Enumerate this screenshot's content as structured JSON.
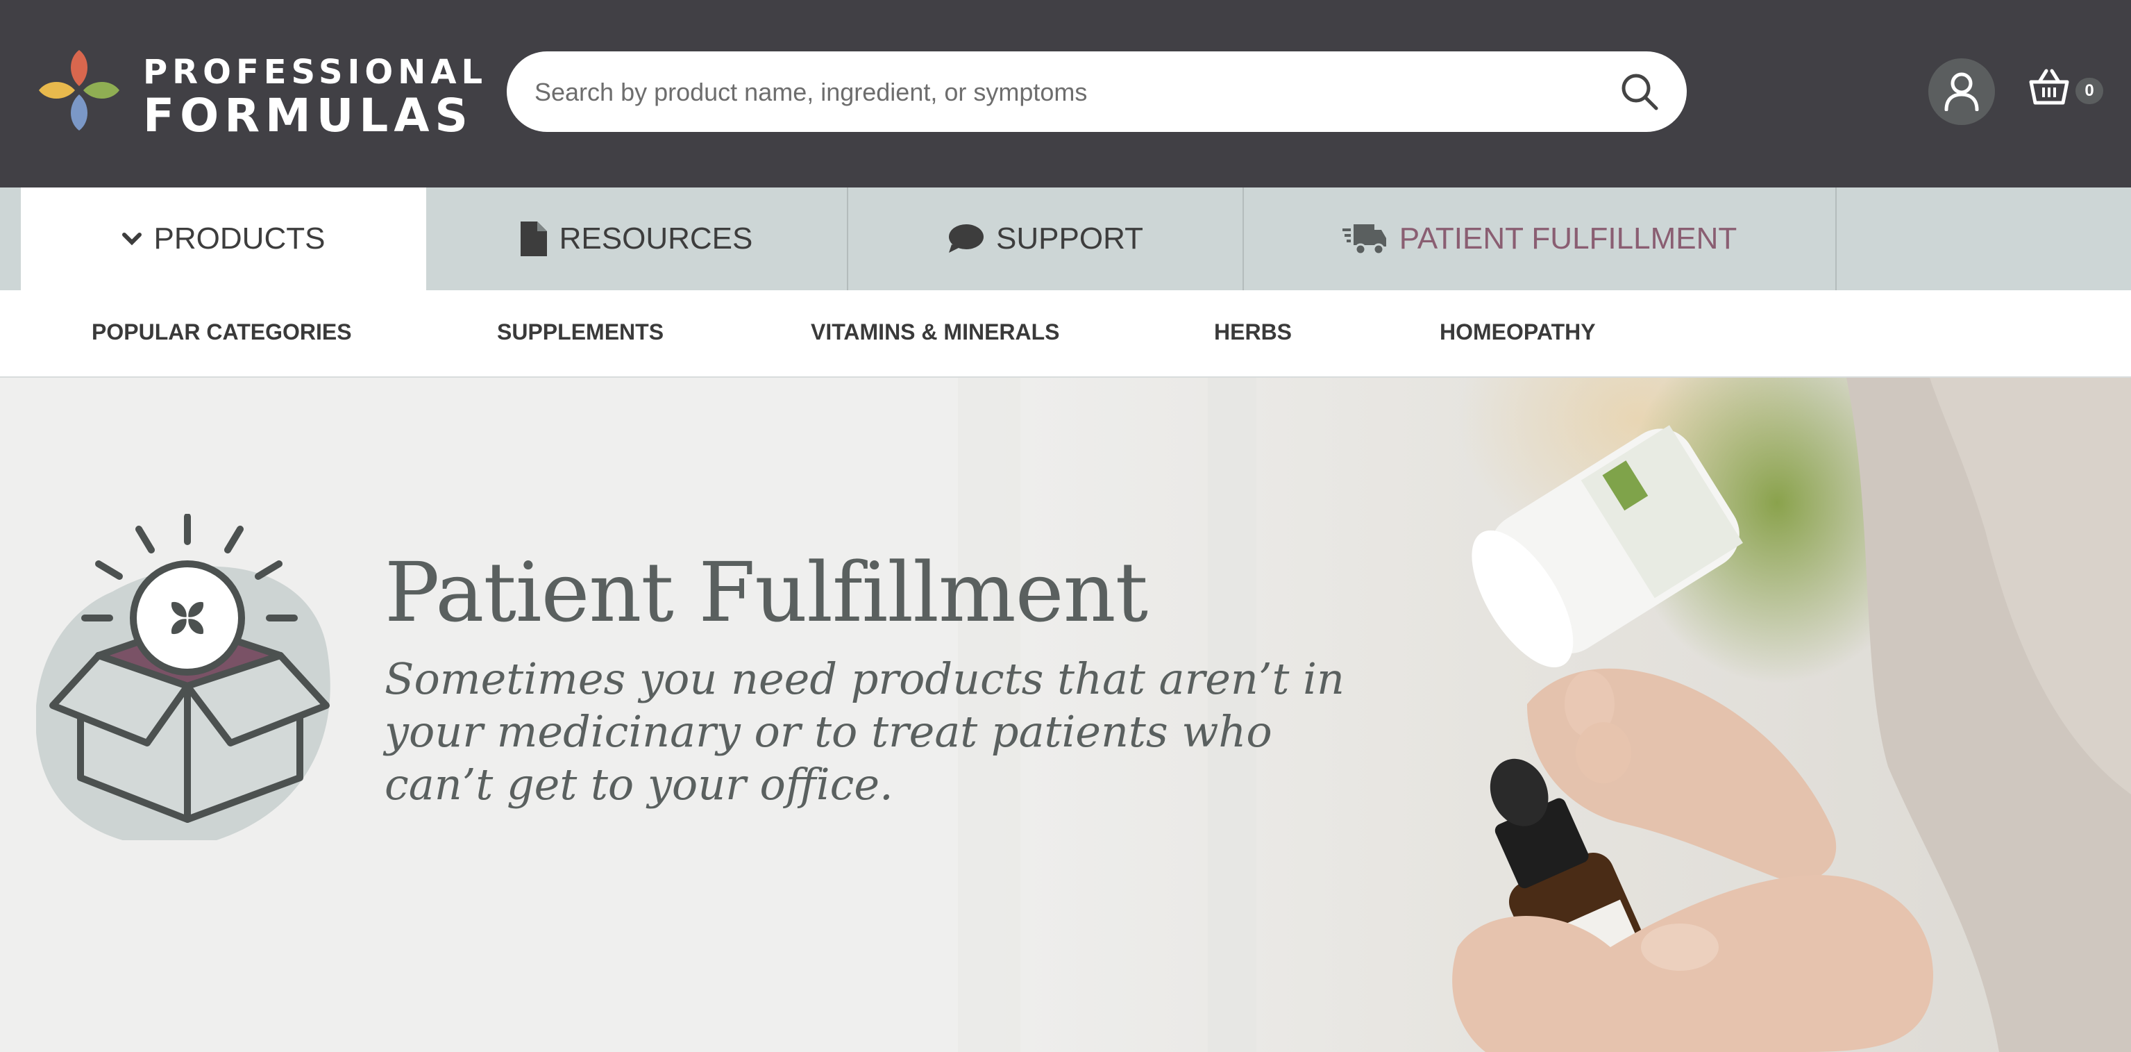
{
  "brand": {
    "line1": "PROFESSIONAL",
    "line2": "FORMULAS",
    "colors": {
      "red": "#d9674e",
      "yellow": "#e8b94d",
      "green": "#8fae53",
      "blue": "#7b98c7"
    }
  },
  "search": {
    "placeholder": "Search by product name, ingredient, or symptoms",
    "value": "",
    "icon": "search-icon"
  },
  "account": {
    "icon": "user-icon"
  },
  "cart": {
    "icon": "basket-icon",
    "count": "0"
  },
  "nav": {
    "tabs": [
      {
        "label": "PRODUCTS",
        "icon": "chevron-down-icon"
      },
      {
        "label": "RESOURCES",
        "icon": "document-icon"
      },
      {
        "label": "SUPPORT",
        "icon": "chat-bubble-icon"
      },
      {
        "label": "PATIENT FULFILLMENT",
        "icon": "delivery-truck-icon",
        "color": "#8a5e72"
      }
    ]
  },
  "subnav": {
    "items": [
      {
        "label": "POPULAR CATEGORIES"
      },
      {
        "label": "SUPPLEMENTS"
      },
      {
        "label": "VITAMINS & MINERALS"
      },
      {
        "label": "HERBS"
      },
      {
        "label": "HOMEOPATHY"
      }
    ]
  },
  "hero": {
    "title": "Patient Fulfillment",
    "subtitle": "Sometimes you need products that aren’t in your medicinary or to treat patients who can’t get to your office.",
    "icon": "open-box-icon"
  },
  "colors": {
    "header_bg": "#414045",
    "nav_bg": "#cdd6d6",
    "accent": "#8a5e72",
    "text": "#5a605f"
  }
}
